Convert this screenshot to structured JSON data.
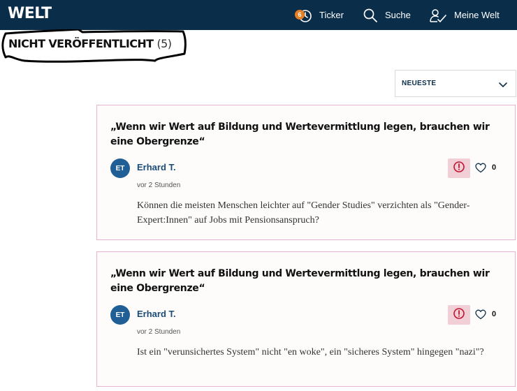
{
  "header": {
    "logo": "WELT",
    "ticker_badge": "6",
    "ticker_label": "Ticker",
    "search_label": "Suche",
    "account_label": "Meine Welt"
  },
  "section": {
    "title": "NICHT VERÖFFENTLICHT",
    "count": "(5)"
  },
  "sort": {
    "selected": "NEUESTE"
  },
  "comments": [
    {
      "title": "„Wenn wir Wert auf Bildung und Wertevermittlung legen, brauchen wir eine Obergrenze“",
      "initials": "ET",
      "author": "Erhard T.",
      "time": "vor 2 Stunden",
      "likes": "0",
      "body": "Können die meisten Menschen leichter auf \"Gender Studies\" verzichten als \"Gender-Expert:Innen\" auf Jobs mit Pensionsanspruch?"
    },
    {
      "title": "„Wenn wir Wert auf Bildung und Wertevermittlung legen, brauchen wir eine Obergrenze“",
      "initials": "ET",
      "author": "Erhard T.",
      "time": "vor 2 Stunden",
      "likes": "0",
      "body": "Ist ein \"verunsichertes System\" nicht \"en woke\", ein \"sicheres System\" hingegen \"nazi\"?"
    }
  ],
  "colors": {
    "nav_bg": "#0a2d4a",
    "badge": "#e67e22",
    "card_border": "#e7b4d0",
    "report_bg": "#f2cfd6",
    "report_icon": "#c0142f",
    "author": "#1a4c78",
    "avatar_bg": "#1f5f96"
  },
  "icons": {
    "ticker": "clock-icon",
    "search": "search-icon",
    "account": "user-check-icon",
    "sort": "chevron-down-icon",
    "report": "alert-circle-icon",
    "like": "heart-icon"
  }
}
